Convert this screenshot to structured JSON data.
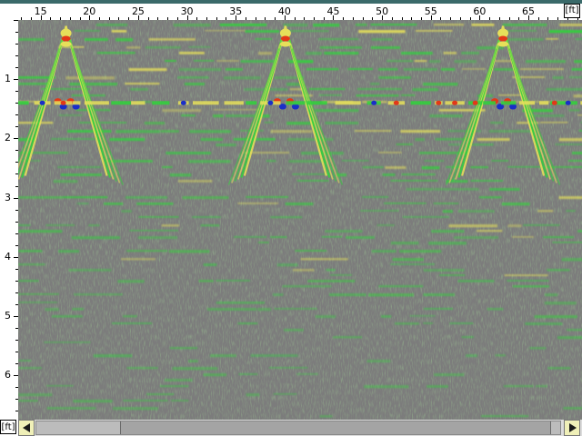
{
  "axes": {
    "x_unit": "[ft]",
    "y_unit": "[ft]",
    "x_ticks": [
      "15",
      "20",
      "25",
      "30",
      "35",
      "40",
      "45",
      "50",
      "55",
      "60",
      "65"
    ],
    "x_values": [
      15,
      20,
      25,
      30,
      35,
      40,
      45,
      50,
      55,
      60,
      65
    ],
    "x_range": [
      12.7,
      70.5
    ],
    "y_ticks": [
      "1",
      "2",
      "3",
      "4",
      "5",
      "6"
    ],
    "y_values": [
      1,
      2,
      3,
      4,
      5,
      6
    ],
    "y_range": [
      0,
      6.75
    ]
  },
  "hyperbolas": [
    {
      "apex_x": 17.6,
      "apex_y": 0.1
    },
    {
      "apex_x": 40.1,
      "apex_y": 0.1
    },
    {
      "apex_x": 62.4,
      "apex_y": 0.1
    }
  ],
  "reflector_depth": 1.4,
  "scroll": {
    "position": 0.16,
    "visible_fraction": 0.82
  },
  "colors": {
    "background": "#7c7c7c",
    "green": "#2fd43a",
    "yellow": "#e6e05a",
    "red": "#e23818",
    "blue": "#1a2ec8",
    "title_bar": "#3a6a6a"
  },
  "icons": {
    "scroll_left": "left-arrow-icon",
    "scroll_right": "right-arrow-icon"
  }
}
